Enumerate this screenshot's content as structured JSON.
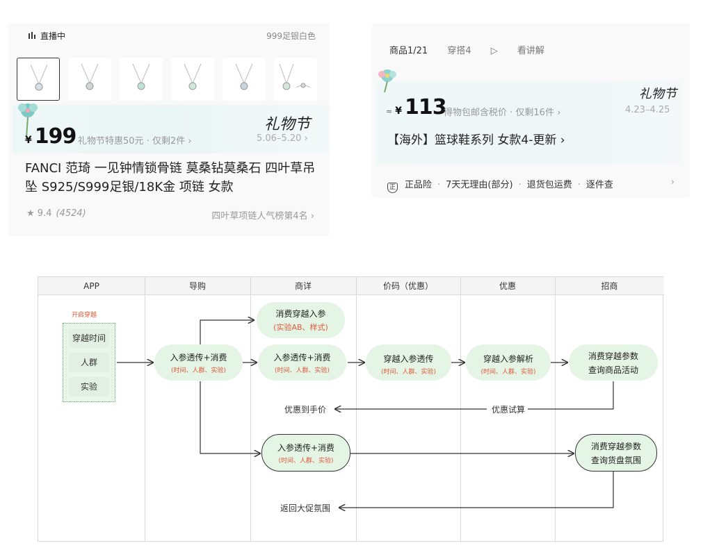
{
  "card1": {
    "live_label": "直播中",
    "variant": "999足银白色",
    "thumb_count": 6,
    "price_symbol": "¥",
    "price": "199",
    "promo": "礼物节特惠50元 · 仅剩2件 ›",
    "festival_brand": "礼物节",
    "dates": "5.06–5.20 ›",
    "title": "FANCI 范琦 一见钟情锁骨链 莫桑钻莫桑石 四叶草吊坠 S925/S999足银/18K金 项链 女款",
    "rating": "9.4",
    "rating_count": "(4524)",
    "rank": "四叶草项链人气榜第4名 ›"
  },
  "card2": {
    "tab_goods": "商品1/21",
    "tab_outfit": "穿搭4",
    "tab_explain": "看讲解",
    "approx": "≈",
    "price_symbol": "¥",
    "price": "113",
    "promo": "得物包邮含税价 · 仅剩16件 ›",
    "festival_brand": "礼物节",
    "dates": "4.23–4.25",
    "title": "【海外】篮球鞋系列 女款4-更新 ›",
    "services": [
      "正品险",
      "7天无理由(部分)",
      "退货包运费",
      "逐件查"
    ],
    "shield_glyph": "正",
    "more_arrow": "›"
  },
  "diagram": {
    "lanes": [
      "APP",
      "导购",
      "商详",
      "价码（优惠）",
      "优惠",
      "招商"
    ],
    "app_title": "开启穿越",
    "app_items": [
      "穿越时间",
      "人群",
      "实验"
    ],
    "nodes": {
      "n_guide": {
        "t1": "入参透传+消费",
        "t2": "(时间、人群、实验)"
      },
      "n_detail_top": {
        "t1": "消费穿越入参",
        "t2": "(实验AB、样式)"
      },
      "n_detail_mid": {
        "t1": "入参透传+消费",
        "t2": "(时间、人群、实验)"
      },
      "n_price": {
        "t1": "穿越入参透传",
        "t2": "(时间、人群、实验)"
      },
      "n_promo": {
        "t1": "穿越入参解析",
        "t2": "(时间、人群、实验)"
      },
      "n_biz1": {
        "t1": "消费穿越参数",
        "t2": "查询商品活动"
      },
      "n_detail_low": {
        "t1": "入参透传+消费",
        "t2": "(时间、人群、实验)"
      },
      "n_biz2": {
        "t1": "消费穿越参数",
        "t2": "查询货盘氛围"
      }
    },
    "labels": {
      "to_hand_price": "优惠到手价",
      "promo_calc": "优惠试算",
      "return_promo": "返回大促氛围"
    }
  },
  "colors": {
    "node_fill": "#e4f4e5",
    "accent_orange": "#e0593a",
    "app_border": "#5aa86d"
  }
}
